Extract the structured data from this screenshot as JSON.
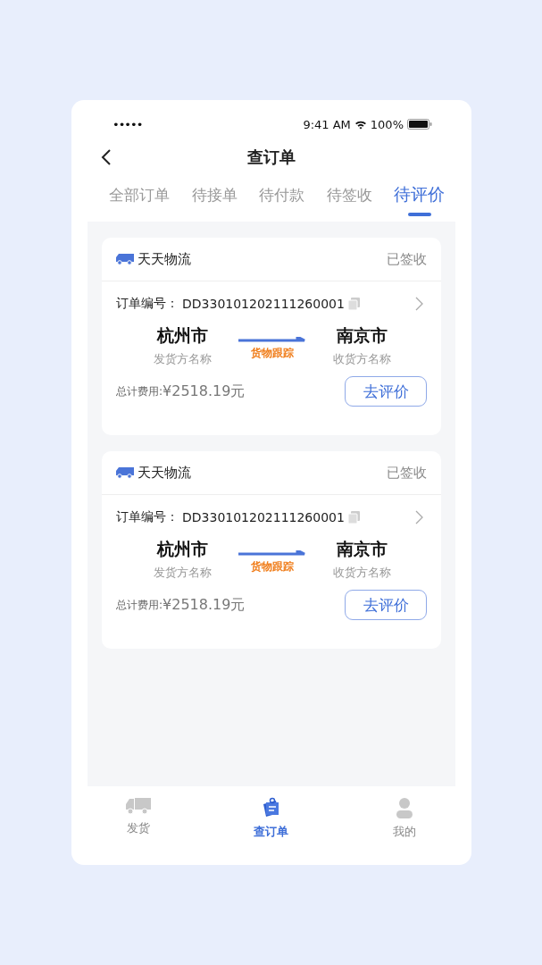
{
  "status_bar": {
    "signal": "•••••",
    "time": "9:41 AM",
    "battery": "100%"
  },
  "nav": {
    "title": "查订单"
  },
  "tabs": [
    {
      "label": "全部订单",
      "selected": false
    },
    {
      "label": "待接单",
      "selected": false
    },
    {
      "label": "待付款",
      "selected": false
    },
    {
      "label": "待签收",
      "selected": false
    },
    {
      "label": "待评价",
      "selected": true
    }
  ],
  "orders": [
    {
      "carrier": "天天物流",
      "status": "已签收",
      "order_label": "订单编号：",
      "order_no": "DD330101202111260001",
      "from_city": "杭州市",
      "from_name": "发货方名称",
      "track": "货物跟踪",
      "to_city": "南京市",
      "to_name": "收货方名称",
      "total_label": "总计费用:",
      "total": "¥2518.19元",
      "action": "去评价"
    },
    {
      "carrier": "天天物流",
      "status": "已签收",
      "order_label": "订单编号：",
      "order_no": "DD330101202111260001",
      "from_city": "杭州市",
      "from_name": "发货方名称",
      "track": "货物跟踪",
      "to_city": "南京市",
      "to_name": "收货方名称",
      "total_label": "总计费用:",
      "total": "¥2518.19元",
      "action": "去评价"
    }
  ],
  "tabbar": [
    {
      "kind": "truck",
      "label": "发货",
      "selected": false
    },
    {
      "kind": "orders",
      "label": "查订单",
      "selected": true
    },
    {
      "kind": "person",
      "label": "我的",
      "selected": false
    }
  ]
}
